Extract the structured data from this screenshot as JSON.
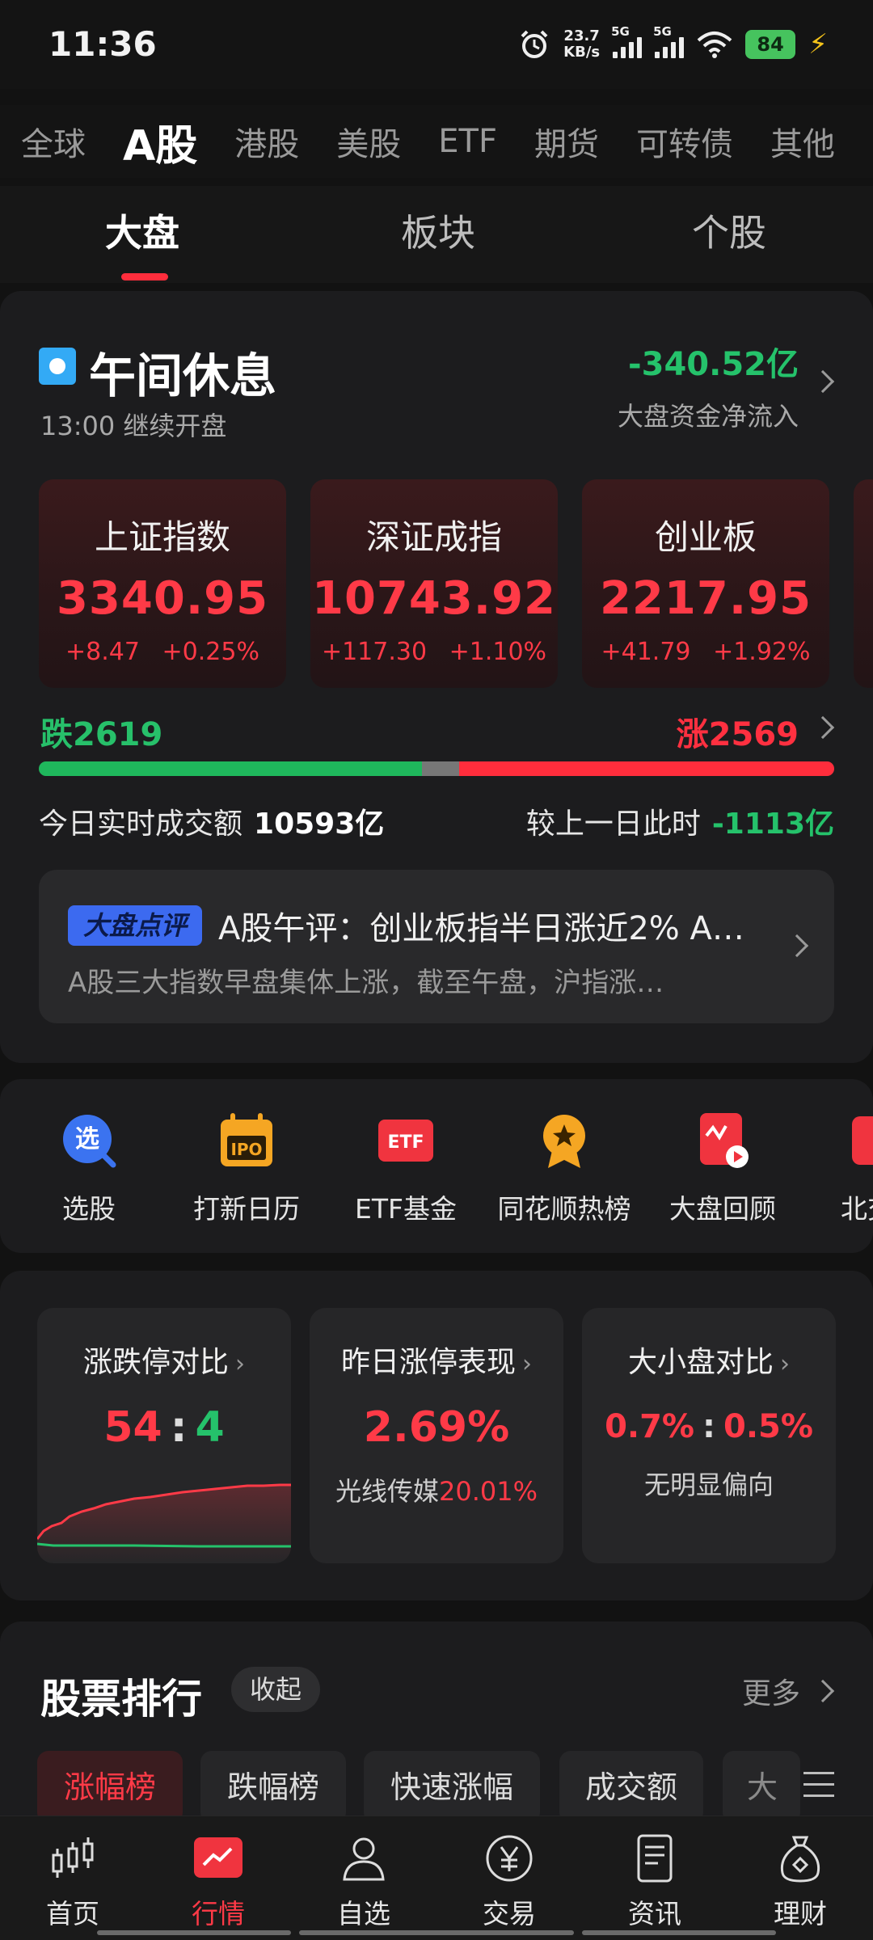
{
  "status_bar": {
    "time": "11:36",
    "net_speed_value": "23.7",
    "net_speed_unit": "KB/s",
    "signal1": "5G",
    "signal2": "5G",
    "battery": "84"
  },
  "market_tabs": [
    "全球",
    "A股",
    "港股",
    "美股",
    "ETF",
    "期货",
    "可转债",
    "其他"
  ],
  "market_active": "A股",
  "sub_tabs": [
    "大盘",
    "板块",
    "个股"
  ],
  "session": {
    "title": "午间休息",
    "subtitle": "13:00 继续开盘",
    "net_flow_value": "-340.52亿",
    "net_flow_label": "大盘资金净流入"
  },
  "indices": [
    {
      "name": "上证指数",
      "value": "3340.95",
      "change": "+8.47",
      "pct": "+0.25%"
    },
    {
      "name": "深证成指",
      "value": "10743.92",
      "change": "+117.30",
      "pct": "+1.10%"
    },
    {
      "name": "创业板",
      "value": "2217.95",
      "change": "+41.79",
      "pct": "+1.92%"
    }
  ],
  "breadth": {
    "down_label": "跌2619",
    "up_label": "涨2569",
    "down": 2619,
    "up": 2569
  },
  "turnover": {
    "label": "今日实时成交额",
    "value": "10593亿",
    "compare_label": "较上一日此时",
    "compare_value": "-1113亿"
  },
  "news": {
    "badge": "大盘点评",
    "title": "A股午评：创业板指半日涨近2% A…",
    "summary": "A股三大指数早盘集体上涨，截至午盘，沪指涨…"
  },
  "shortcuts": [
    {
      "label": "选股",
      "icon": "stock-pick-icon"
    },
    {
      "label": "打新日历",
      "icon": "ipo-calendar-icon"
    },
    {
      "label": "ETF基金",
      "icon": "etf-icon"
    },
    {
      "label": "同花顺热榜",
      "icon": "hot-list-icon"
    },
    {
      "label": "大盘回顾",
      "icon": "review-icon"
    },
    {
      "label": "北交",
      "icon": "bse-icon"
    }
  ],
  "stats": {
    "limit": {
      "title": "涨跌停对比",
      "up": "54",
      "sep": ":",
      "down": "4"
    },
    "yesterday": {
      "title": "昨日涨停表现",
      "value": "2.69%",
      "sub_label": "光线传媒",
      "sub_value": "20.01%"
    },
    "size": {
      "title": "大小盘对比",
      "large": "0.7%",
      "sep": ":",
      "small": "0.5%",
      "sub": "无明显偏向"
    }
  },
  "ranking": {
    "title": "股票排行",
    "collapse": "收起",
    "more": "更多",
    "tabs": [
      "涨幅榜",
      "跌幅榜",
      "快速涨幅",
      "成交额",
      "大"
    ]
  },
  "bottom_nav": [
    {
      "label": "首页",
      "icon": "home-candlestick-icon"
    },
    {
      "label": "行情",
      "icon": "market-chart-icon"
    },
    {
      "label": "自选",
      "icon": "watchlist-person-icon"
    },
    {
      "label": "交易",
      "icon": "trade-yen-icon"
    },
    {
      "label": "资讯",
      "icon": "news-doc-icon"
    },
    {
      "label": "理财",
      "icon": "wealth-bag-icon"
    }
  ],
  "colors": {
    "up": "#ff3a47",
    "down": "#25c26b",
    "background": "#121212",
    "card": "#1c1c1e"
  }
}
